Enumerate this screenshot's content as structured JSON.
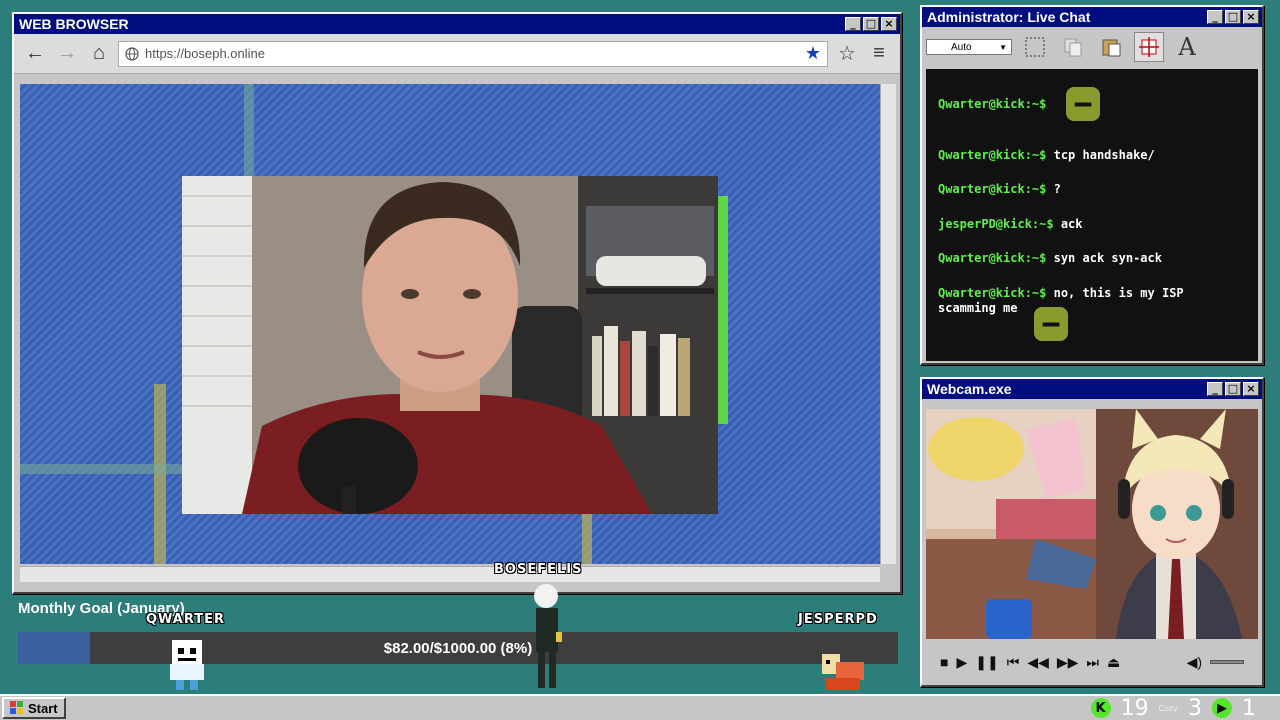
{
  "browser": {
    "title": "WEB BROWSER",
    "url": "https://boseph.online",
    "back_icon": "←",
    "forward_icon": "→",
    "home_icon": "⌂",
    "menu_icon": "≡",
    "bookmarked_star": "★",
    "bookmark_star": "☆"
  },
  "window_buttons": {
    "minimize": "_",
    "maximize": "□",
    "close": "×"
  },
  "chat": {
    "title": "Administrator: Live Chat",
    "select_value": "Auto",
    "text_tool": "A",
    "messages": [
      {
        "user": "Qwarter@kick:~$",
        "text": ""
      },
      {
        "user": "Qwarter@kick:~$",
        "text": "tcp handshake/"
      },
      {
        "user": "Qwarter@kick:~$",
        "text": "?"
      },
      {
        "user": "jesperPD@kick:~$",
        "text": "ack"
      },
      {
        "user": "Qwarter@kick:~$",
        "text": "syn ack syn-ack"
      },
      {
        "user": "Qwarter@kick:~$",
        "text": "no, this is my ISP"
      }
    ],
    "continuation": "scamming me"
  },
  "webcam": {
    "title": "Webcam.exe",
    "stop": "■",
    "play": "▶",
    "pause": "❚❚",
    "prev": "⏮",
    "rewind": "◀◀",
    "forward": "▶▶",
    "next": "⏭",
    "eject": "⏏",
    "volume": "◀)"
  },
  "goal": {
    "title": "Monthly Goal (January)",
    "text": "$82.00/$1000.00 (8%)",
    "progress": 0.082
  },
  "players": {
    "left": "QWARTER",
    "center": "BOSEFELIS",
    "right": "JESPERPD"
  },
  "taskbar": {
    "start": "Start",
    "kick_icon": "K",
    "count_a": "19",
    "count_b": "3",
    "count_c": "1",
    "tiny_label": "Cozy"
  },
  "colors": {
    "desktop": "#2d7d7a",
    "titlebar": "#000e80",
    "chat_user": "#5df04a",
    "kick_green": "#53e62a"
  }
}
